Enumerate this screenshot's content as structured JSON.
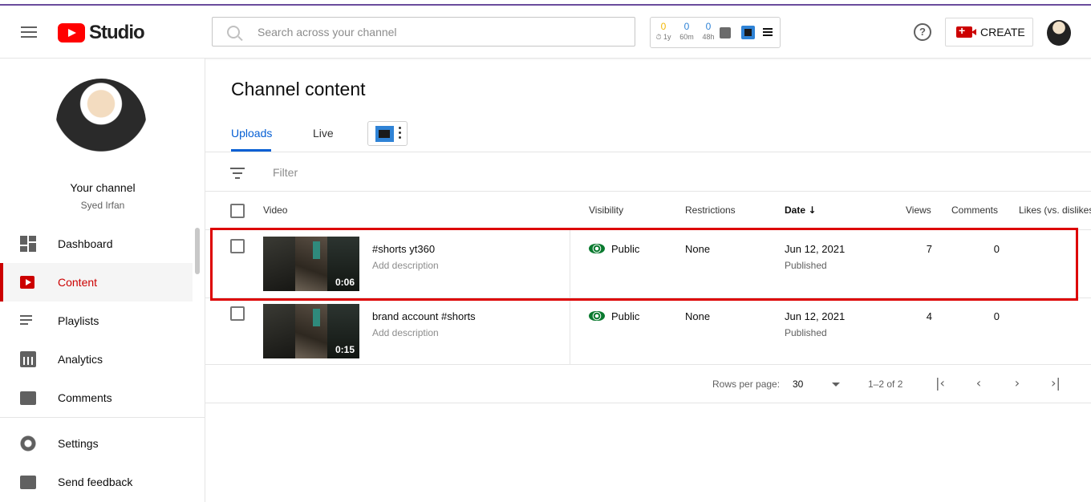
{
  "app": {
    "logo_text": "Studio",
    "search_placeholder": "Search across your channel",
    "create_label": "CREATE"
  },
  "extension": {
    "stats": [
      {
        "value": "0",
        "label": "1y",
        "color": "#f2b705"
      },
      {
        "value": "0",
        "label": "60m",
        "color": "#2f83d6"
      },
      {
        "value": "0",
        "label": "48h",
        "color": "#2f83d6"
      }
    ]
  },
  "sidebar": {
    "channel_name": "Your channel",
    "channel_owner": "Syed Irfan",
    "items": [
      {
        "label": "Dashboard",
        "icon": "dashboard-icon",
        "active": false
      },
      {
        "label": "Content",
        "icon": "content-icon",
        "active": true
      },
      {
        "label": "Playlists",
        "icon": "playlists-icon",
        "active": false
      },
      {
        "label": "Analytics",
        "icon": "analytics-icon",
        "active": false
      },
      {
        "label": "Comments",
        "icon": "comments-icon",
        "active": false
      },
      {
        "label": "Settings",
        "icon": "settings-icon",
        "active": false
      },
      {
        "label": "Send feedback",
        "icon": "feedback-icon",
        "active": false
      }
    ]
  },
  "main": {
    "title": "Channel content",
    "tabs": [
      {
        "label": "Uploads",
        "active": true
      },
      {
        "label": "Live",
        "active": false
      }
    ],
    "filter_placeholder": "Filter"
  },
  "table": {
    "columns": [
      "Video",
      "Visibility",
      "Restrictions",
      "Date",
      "Views",
      "Comments",
      "Likes (vs. dislikes)"
    ],
    "sort_indicator": "↓",
    "rows": [
      {
        "title": "#shorts yt360",
        "description": "Add description",
        "duration": "0:06",
        "visibility": "Public",
        "restrictions": "None",
        "date": "Jun 12, 2021",
        "status": "Published",
        "views": "7",
        "comments": "0"
      },
      {
        "title": "brand account #shorts",
        "description": "Add description",
        "duration": "0:15",
        "visibility": "Public",
        "restrictions": "None",
        "date": "Jun 12, 2021",
        "status": "Published",
        "views": "4",
        "comments": "0"
      }
    ]
  },
  "pagination": {
    "rows_per_page_label": "Rows per page:",
    "rows_per_page_value": "30",
    "range": "1–2 of 2"
  },
  "colors": {
    "accent": "#cc0000",
    "link": "#065fd4",
    "public": "#0a7a2f",
    "highlight": "#dd0000"
  }
}
